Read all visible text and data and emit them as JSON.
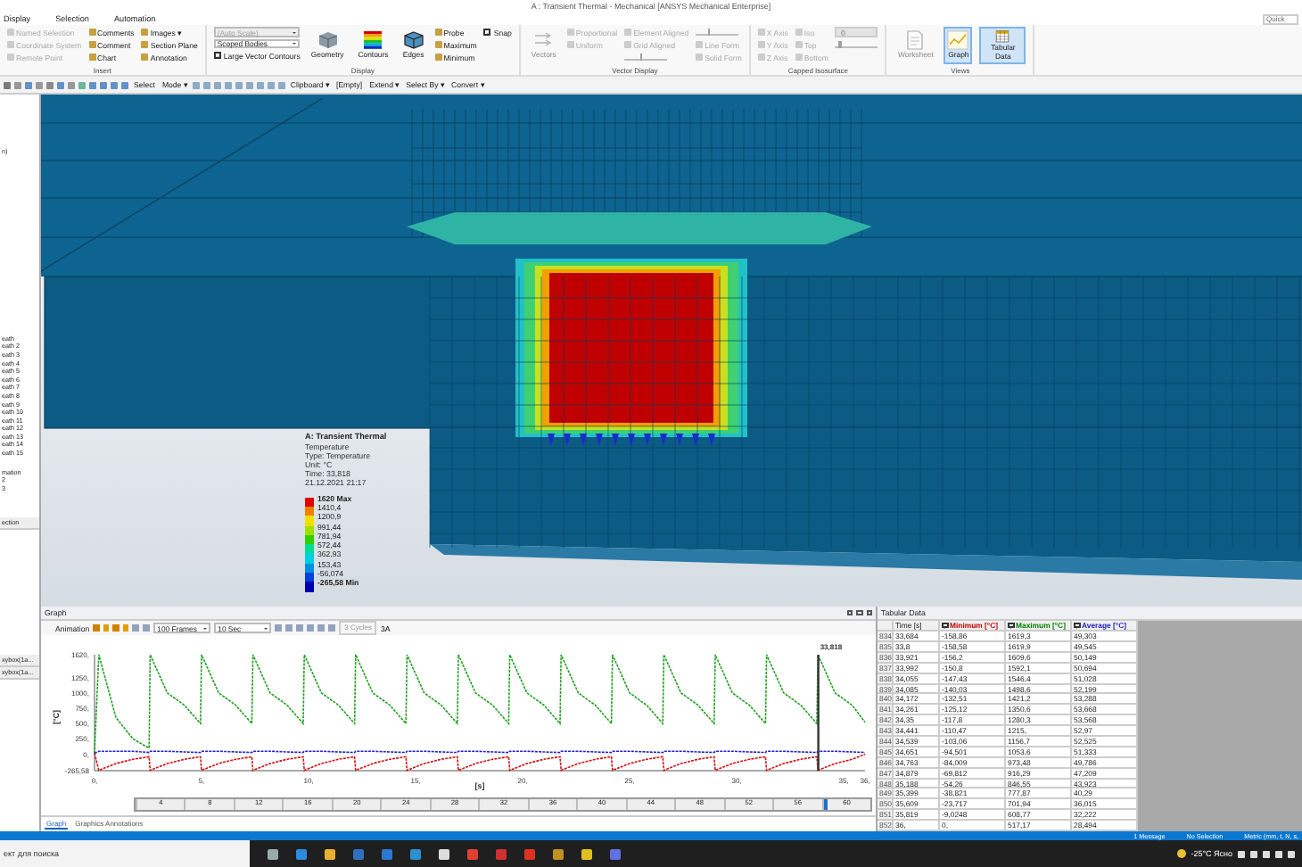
{
  "window": {
    "title": "A : Transient Thermal - Mechanical [ANSYS Mechanical Enterprise]",
    "quick_launch": {
      "placeholder": "Quick"
    }
  },
  "ribbon_tabs": [
    "Display",
    "Selection",
    "Automation"
  ],
  "ribbon_groups": [
    {
      "label": "Insert",
      "columns": [
        [
          {
            "kind": "small",
            "label": "Named Selection",
            "disabled": true
          },
          {
            "kind": "small",
            "label": "Coordinate System",
            "disabled": true
          },
          {
            "kind": "small",
            "label": "Remote Point",
            "disabled": true
          }
        ],
        [
          {
            "kind": "small",
            "label": "Comments",
            "disabled": false
          },
          {
            "kind": "small",
            "label": "Comment",
            "disabled": false
          },
          {
            "kind": "small",
            "label": "Chart",
            "disabled": false
          }
        ],
        [
          {
            "kind": "small",
            "label": "Images ▾",
            "disabled": false
          },
          {
            "kind": "small",
            "label": "Section Plane",
            "disabled": false
          },
          {
            "kind": "small",
            "label": "Annotation",
            "disabled": false
          }
        ]
      ]
    },
    {
      "label": "Display",
      "columns": [
        [
          {
            "kind": "dropdown",
            "label": "(Auto Scale)",
            "disabled": true
          },
          {
            "kind": "dropdown",
            "label": "Scoped Bodies",
            "disabled": false
          },
          {
            "kind": "checkbox",
            "label": "Large Vector Contours",
            "checked": true
          }
        ],
        [
          {
            "kind": "large",
            "label": "Geometry",
            "selected": false,
            "disabled": false
          }
        ],
        [
          {
            "kind": "large",
            "label": "Contours",
            "selected": false,
            "disabled": false
          }
        ],
        [
          {
            "kind": "large",
            "label": "Edges",
            "selected": false,
            "disabled": false
          }
        ],
        [
          {
            "kind": "small",
            "label": "Probe",
            "disabled": false
          },
          {
            "kind": "small",
            "label": "Maximum",
            "disabled": false
          },
          {
            "kind": "small",
            "label": "Minimum",
            "disabled": false
          }
        ],
        [
          {
            "kind": "checkbox",
            "label": "Snap",
            "checked": true
          }
        ]
      ]
    },
    {
      "label": "Vector Display",
      "columns": [
        [
          {
            "kind": "large",
            "label": "Vectors",
            "selected": false,
            "disabled": true
          }
        ],
        [
          {
            "kind": "small",
            "label": "Proportional",
            "disabled": true
          },
          {
            "kind": "small",
            "label": "Uniform",
            "disabled": true
          }
        ],
        [
          {
            "kind": "small",
            "label": "Element Aligned",
            "disabled": true
          },
          {
            "kind": "small",
            "label": "Grid Aligned",
            "disabled": true
          },
          {
            "kind": "slider",
            "level": 0.4,
            "disabled": true
          }
        ],
        [
          {
            "kind": "slider",
            "level": 0.3,
            "disabled": true
          },
          {
            "kind": "small",
            "label": "Line Form",
            "disabled": true
          },
          {
            "kind": "small",
            "label": "Solid Form",
            "disabled": true
          }
        ]
      ]
    },
    {
      "label": "Capped Isosurface",
      "columns": [
        [
          {
            "kind": "small",
            "label": "X Axis",
            "disabled": true
          },
          {
            "kind": "small",
            "label": "Y Axis",
            "disabled": true
          },
          {
            "kind": "small",
            "label": "Z Axis",
            "disabled": true
          }
        ],
        [
          {
            "kind": "small",
            "label": "Iso",
            "disabled": true
          },
          {
            "kind": "small",
            "label": "Top",
            "disabled": true
          },
          {
            "kind": "small",
            "label": "Bottom",
            "disabled": true
          }
        ],
        [
          {
            "kind": "field",
            "value": "0",
            "disabled": true
          },
          {
            "kind": "slider",
            "level": 0.1,
            "disabled": true
          }
        ]
      ]
    },
    {
      "label": "Views",
      "columns": [
        [
          {
            "kind": "large",
            "label": "Worksheet",
            "selected": false,
            "disabled": true
          }
        ],
        [
          {
            "kind": "large",
            "label": "Graph",
            "selected": true,
            "disabled": false
          }
        ],
        [
          {
            "kind": "large",
            "label": "Tabular Data",
            "selected": true,
            "disabled": false
          }
        ]
      ]
    }
  ],
  "toolbar": [
    "Select",
    "Mode ▾",
    "Clipboard ▾",
    "[Empty]",
    "Extend ▾",
    "Select By ▾",
    "Convert ▾"
  ],
  "tree_fragments": [
    "n)",
    "eath",
    "eath 2",
    "eath 3",
    "eath 4",
    "eath 5",
    "eath 6",
    "eath 7",
    "eath 8",
    "eath 9",
    "eath 10",
    "eath 11",
    "eath 12",
    "eath 13",
    "eath 14",
    "eath 15",
    "mation",
    "2",
    "3"
  ],
  "details_fragments": [
    "ection",
    "xybox(1a...",
    "xybox(1a..."
  ],
  "legend": {
    "title": "A: Transient Thermal",
    "lines": [
      "Temperature",
      "Type: Temperature",
      "Unit: °C",
      "Time: 33,818",
      "21.12.2021 21:17"
    ],
    "scale": [
      {
        "label": "1620 Max",
        "color": "#e00000"
      },
      {
        "label": "1410,4",
        "color": "#f08000"
      },
      {
        "label": "1200,9",
        "color": "#f0e000"
      },
      {
        "label": "991,44",
        "color": "#a0e000"
      },
      {
        "label": "781,94",
        "color": "#30d000"
      },
      {
        "label": "572,44",
        "color": "#00e090"
      },
      {
        "label": "362,93",
        "color": "#00d0e0"
      },
      {
        "label": "153,43",
        "color": "#0090e0"
      },
      {
        "label": "-56,074",
        "color": "#0040e0"
      },
      {
        "label": "-265,58 Min",
        "color": "#0000b0"
      }
    ]
  },
  "graph": {
    "title": "Graph",
    "toolbar": {
      "animation": "Animation",
      "frames": "100 Frames",
      "duration": "10 Sec",
      "cycles": "3 Cycles",
      "mode": "3A"
    },
    "chart_data": {
      "type": "line",
      "xlabel": "[s]",
      "ylabel": "[°C]",
      "x": [
        0,
        0.2,
        1,
        1.8,
        2.55,
        2.6,
        3.4,
        4.2,
        4.95,
        5,
        5.8,
        6.6,
        7.35,
        7.4,
        8.2,
        9,
        9.75,
        9.8,
        10.6,
        11.4,
        12.15,
        12.2,
        13,
        13.8,
        14.55,
        14.6,
        15.4,
        16.2,
        16.95,
        17,
        17.8,
        18.6,
        19.35,
        19.4,
        20.2,
        21,
        21.75,
        21.8,
        22.6,
        23.4,
        24.15,
        24.2,
        25,
        25.8,
        26.55,
        26.6,
        27.4,
        28.2,
        28.95,
        29,
        29.8,
        30.6,
        31.35,
        31.4,
        32.2,
        33,
        33.75,
        33.8,
        34.6,
        35.4,
        36
      ],
      "series": [
        {
          "color": "#d01010",
          "line_style": "dashed",
          "values": [
            20,
            -260,
            -150,
            -80,
            -40,
            -260,
            -150,
            -80,
            -40,
            -260,
            -150,
            -80,
            -40,
            -260,
            -150,
            -80,
            -40,
            -260,
            -150,
            -80,
            -40,
            -260,
            -150,
            -80,
            -40,
            -260,
            -150,
            -80,
            -40,
            -260,
            -150,
            -80,
            -40,
            -260,
            -150,
            -80,
            -40,
            -260,
            -150,
            -80,
            -40,
            -260,
            -150,
            -80,
            -40,
            -260,
            -150,
            -80,
            -40,
            -260,
            -150,
            -80,
            -40,
            -260,
            -150,
            -80,
            -40,
            -260,
            -150,
            -80,
            0
          ]
        },
        {
          "color": "#20a020",
          "line_style": "dashed",
          "values": [
            20,
            1620,
            600,
            250,
            100,
            1620,
            1000,
            800,
            500,
            1620,
            1000,
            800,
            500,
            1620,
            1000,
            800,
            500,
            1620,
            1000,
            800,
            500,
            1620,
            1000,
            800,
            500,
            1620,
            1000,
            800,
            500,
            1620,
            1000,
            800,
            500,
            1620,
            1000,
            800,
            500,
            1620,
            1000,
            800,
            500,
            1620,
            1000,
            800,
            500,
            1620,
            1000,
            800,
            500,
            1620,
            1000,
            800,
            500,
            1620,
            1000,
            800,
            500,
            1620,
            1000,
            800,
            520
          ]
        },
        {
          "color": "#2020d0",
          "line_style": "dashed",
          "values": [
            20,
            50,
            50,
            50,
            30,
            50,
            50,
            40,
            30,
            50,
            50,
            40,
            30,
            50,
            50,
            40,
            30,
            50,
            50,
            40,
            30,
            50,
            50,
            40,
            30,
            50,
            50,
            40,
            30,
            50,
            50,
            40,
            30,
            50,
            50,
            40,
            30,
            50,
            50,
            40,
            30,
            50,
            50,
            40,
            30,
            50,
            50,
            40,
            30,
            50,
            50,
            40,
            30,
            50,
            50,
            40,
            30,
            50,
            50,
            40,
            30
          ]
        }
      ],
      "xlim": [
        0,
        36
      ],
      "ylim": [
        -265.58,
        1620
      ],
      "xticks": [
        {
          "value": 0,
          "label": "0,"
        },
        {
          "value": 5,
          "label": "5,"
        },
        {
          "value": 10,
          "label": "10,"
        },
        {
          "value": 15,
          "label": "15,"
        },
        {
          "value": 20,
          "label": "20,"
        },
        {
          "value": 25,
          "label": "25,"
        },
        {
          "value": 30,
          "label": "30,"
        },
        {
          "value": 35,
          "label": "35,"
        },
        {
          "value": 36,
          "label": "36,"
        }
      ],
      "yticks": [
        {
          "value": 1620,
          "label": "1620,"
        },
        {
          "value": 1250,
          "label": "1250,"
        },
        {
          "value": 1000,
          "label": "1000,"
        },
        {
          "value": 750,
          "label": "750,"
        },
        {
          "value": 500,
          "label": "500,"
        },
        {
          "value": 250,
          "label": "250,"
        },
        {
          "value": 0,
          "label": "0,"
        },
        {
          "value": -265.58,
          "label": "-265,58"
        }
      ],
      "ref_lines": [
        {
          "axis": "x",
          "value": 33.818
        }
      ],
      "annotations": [
        {
          "x": 33.818,
          "text": "33,818"
        }
      ]
    },
    "timeline": {
      "labels": [
        "4",
        "8",
        "12",
        "16",
        "20",
        "24",
        "28",
        "32",
        "36",
        "40",
        "44",
        "48",
        "52",
        "56",
        "60"
      ],
      "level": 0.94
    },
    "tabs": [
      {
        "label": "Graph",
        "selected": true
      },
      {
        "label": "Graphics Annotations",
        "selected": false
      }
    ]
  },
  "table": {
    "title": "Tabular Data",
    "columns": [
      {
        "label": "Time [s]"
      },
      {
        "label": "Minimum [°C]",
        "checked": true,
        "color": "#c00000"
      },
      {
        "label": "Maximum [°C]",
        "checked": true,
        "color": "#008000"
      },
      {
        "label": "Average [°C]",
        "checked": true,
        "color": "#2020c0"
      }
    ],
    "rows": [
      {
        "number": "834",
        "cells": [
          "33,684",
          "-158,86",
          "1619,3",
          "49,303"
        ]
      },
      {
        "number": "835",
        "cells": [
          "33,8",
          "-158,58",
          "1619,9",
          "49,545"
        ]
      },
      {
        "number": "836",
        "cells": [
          "33,921",
          "-156,2",
          "1609,6",
          "50,149"
        ]
      },
      {
        "number": "837",
        "cells": [
          "33,992",
          "-150,8",
          "1592,1",
          "50,694"
        ]
      },
      {
        "number": "838",
        "cells": [
          "34,055",
          "-147,43",
          "1546,4",
          "51,028"
        ]
      },
      {
        "number": "839",
        "cells": [
          "34,085",
          "-140,03",
          "1498,6",
          "52,199"
        ]
      },
      {
        "number": "840",
        "cells": [
          "34,172",
          "-132,51",
          "1421,2",
          "53,288"
        ]
      },
      {
        "number": "841",
        "cells": [
          "34,261",
          "-125,12",
          "1350,6",
          "53,668"
        ]
      },
      {
        "number": "842",
        "cells": [
          "34,35",
          "-117,8",
          "1280,3",
          "53,568"
        ]
      },
      {
        "number": "843",
        "cells": [
          "34,441",
          "-110,47",
          "1215,",
          "52,97"
        ]
      },
      {
        "number": "844",
        "cells": [
          "34,539",
          "-103,06",
          "1156,7",
          "52,525"
        ]
      },
      {
        "number": "845",
        "cells": [
          "34,651",
          "-94,501",
          "1053,6",
          "51,333"
        ]
      },
      {
        "number": "846",
        "cells": [
          "34,763",
          "-84,009",
          "973,48",
          "49,786"
        ]
      },
      {
        "number": "847",
        "cells": [
          "34,879",
          "-69,812",
          "916,29",
          "47,209"
        ]
      },
      {
        "number": "848",
        "cells": [
          "35,188",
          "-54,26",
          "846,55",
          "43,923"
        ]
      },
      {
        "number": "849",
        "cells": [
          "35,399",
          "-38,821",
          "777,87",
          "40,29"
        ]
      },
      {
        "number": "850",
        "cells": [
          "35,609",
          "-23,717",
          "701,94",
          "36,015"
        ]
      },
      {
        "number": "851",
        "cells": [
          "35,819",
          "-9,0248",
          "608,77",
          "32,222"
        ]
      },
      {
        "number": "852",
        "cells": [
          "36,",
          "0,",
          "517,17",
          "28,494"
        ]
      }
    ]
  },
  "status_bar": [
    "1 Message",
    "No Selection",
    "Metric (mm, t, N, s,"
  ],
  "taskbar": {
    "search_placeholder": "ект для поиска",
    "weather": "-25°C Ясно"
  }
}
